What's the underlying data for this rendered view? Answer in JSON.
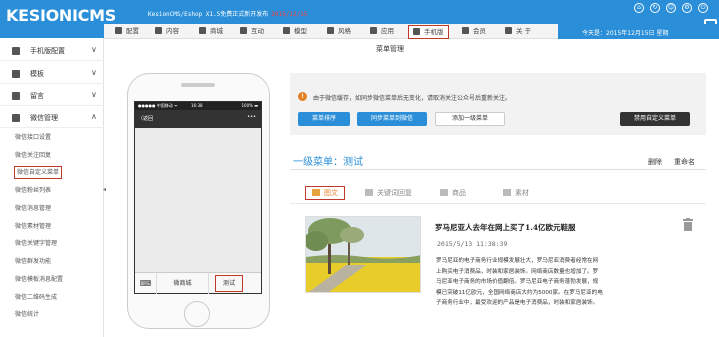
{
  "header": {
    "logo_main": "KESION",
    "logo_cms": "ICMS",
    "version": "KesionCMS/Eshop X1.5免费正式新开发布",
    "version_red": "2015/12/15",
    "date": "今天是：2015年12月15日 星期",
    "colors": {
      "bar": "#2a8fd8",
      "active_border": "#c0392b"
    }
  },
  "nav": {
    "items": [
      {
        "label": "配置",
        "icon": "gear-icon"
      },
      {
        "label": "内容",
        "icon": "document-icon"
      },
      {
        "label": "商城",
        "icon": "shop-icon"
      },
      {
        "label": "互动",
        "icon": "users-icon"
      },
      {
        "label": "模型",
        "icon": "grid-icon"
      },
      {
        "label": "风格",
        "icon": "tag-icon"
      },
      {
        "label": "应用",
        "icon": "monitor-icon"
      },
      {
        "label": "手机版",
        "icon": "menu-icon"
      },
      {
        "label": "会员",
        "icon": "user-icon"
      },
      {
        "label": "关 于",
        "icon": "menu-icon"
      }
    ]
  },
  "sidebar": {
    "sections": [
      {
        "label": "手机版配置",
        "icon": "gear-icon",
        "chevron": "∨"
      },
      {
        "label": "模板",
        "icon": "template-icon",
        "chevron": "∨"
      },
      {
        "label": "留言",
        "icon": "message-icon",
        "chevron": "∨"
      },
      {
        "label": "微信管理",
        "icon": "wechat-icon",
        "chevron": "∧"
      }
    ],
    "items": [
      {
        "label": "微信接口设置"
      },
      {
        "label": "微信关注回复"
      },
      {
        "label": "微信自定义菜单"
      },
      {
        "label": "微信粉丝列表"
      },
      {
        "label": "微信消息管理"
      },
      {
        "label": "微信素材管理"
      },
      {
        "label": "微信关键字管理"
      },
      {
        "label": "微信群发功能"
      },
      {
        "label": "微信模板消息配置"
      },
      {
        "label": "微信二维码生成"
      },
      {
        "label": "微信统计"
      }
    ]
  },
  "page_title": "菜单管理",
  "phone": {
    "status_left": "●●●●● 中国移动 ᯤ",
    "status_time": "16:38",
    "status_right": "100% ▬",
    "back": "〈返回",
    "more": "•••",
    "keyboard_icon": "⌨",
    "menu": [
      "微商城",
      "测试"
    ]
  },
  "notice": {
    "text": "由于微信缓存，如同步微信菜单后无变化，请取消关注公众号后重新关注。",
    "buttons": {
      "sort": "菜单排序",
      "sync": "同步菜单到微信",
      "add": "添加一级菜单",
      "disable": "禁用自定义菜单"
    }
  },
  "menu_level": {
    "title": "一级菜单：测试",
    "delete": "删除",
    "rename": "重命名"
  },
  "tabs": [
    {
      "label": "图文",
      "icon": "image-icon"
    },
    {
      "label": "关键词回复",
      "icon": "pencil-icon"
    },
    {
      "label": "商品",
      "icon": "bag-icon"
    },
    {
      "label": "素材",
      "icon": "image-icon"
    }
  ],
  "article": {
    "title": "罗马尼亚人去年在网上买了1.4亿欧元鞋服",
    "date": "2015/5/13 11:38:39",
    "lines": [
      "罗马尼亚的电子商务行业规模发展壮大，罗马尼亚消费者经常在网",
      "上购买电子消费品，时装和家居装饰。网络商店数量也增加了。罗",
      "马尼亚电子商务的市场价值翻倍。罗马尼亚电子商务蓬勃发展，规",
      "模已突破11亿欧元，全国网络商店大约为5000家。在罗马尼亚的电",
      "子商务行业中，最受欢迎的产品是电子消费品，时装和家居装饰。"
    ]
  }
}
